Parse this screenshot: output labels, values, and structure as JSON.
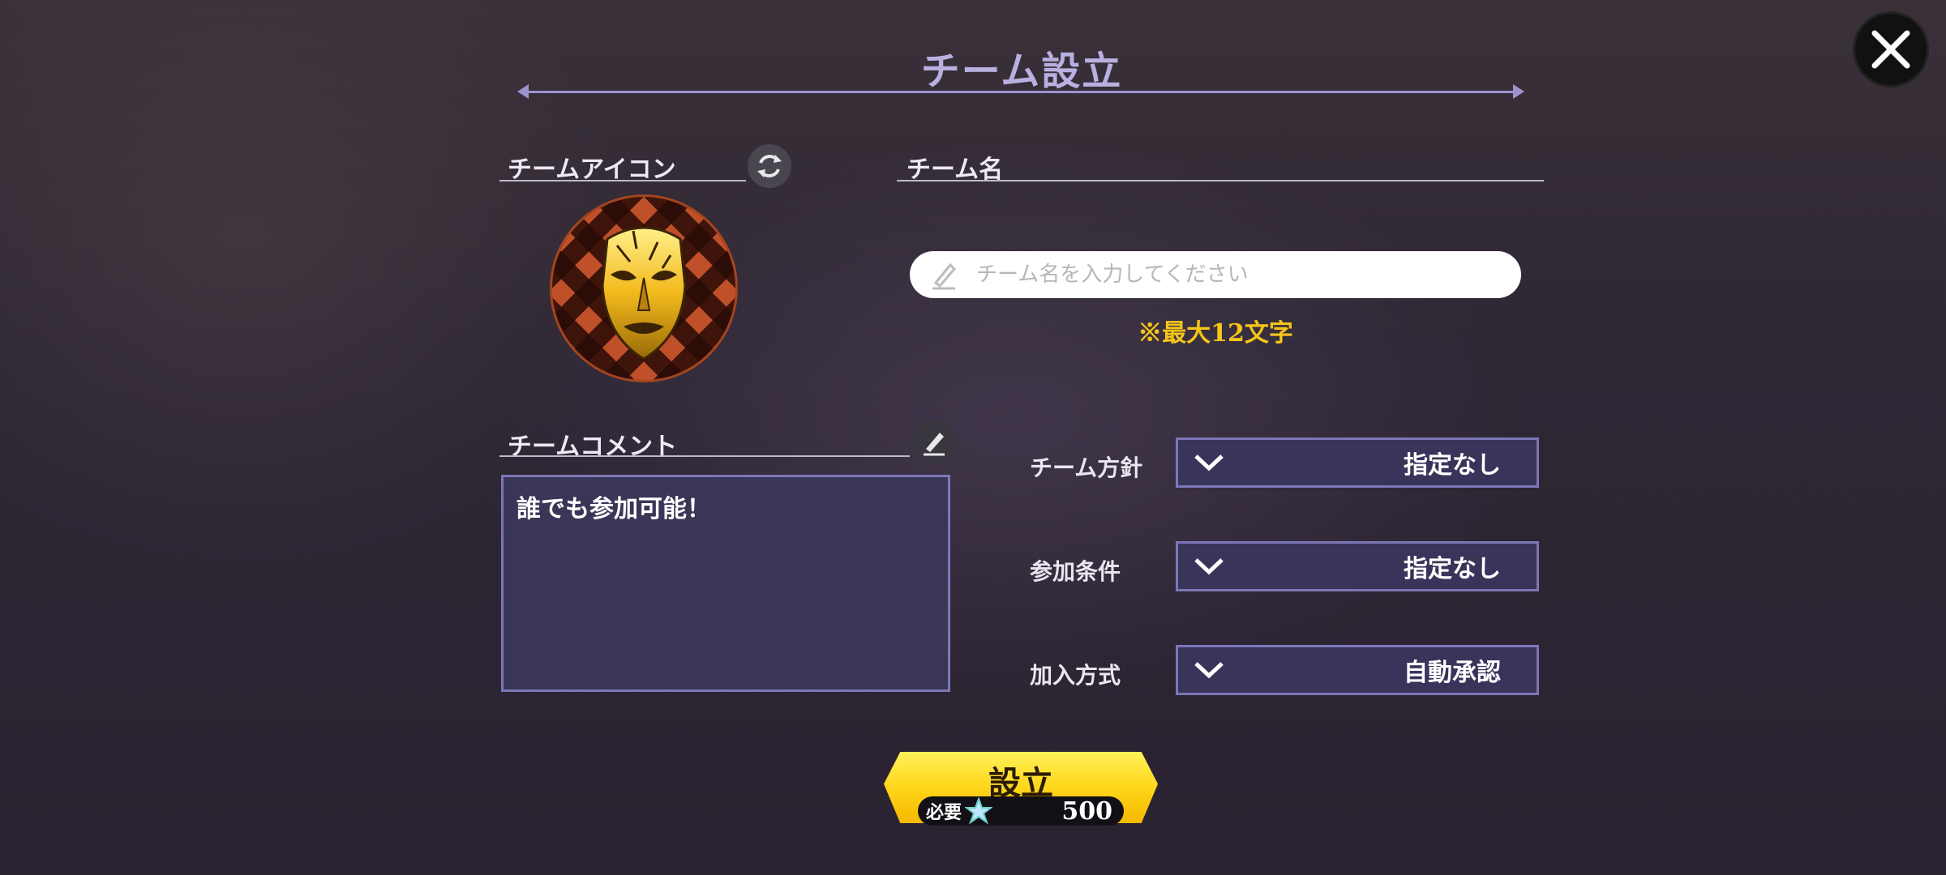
{
  "header": {
    "title": "チーム設立"
  },
  "icon_section": {
    "label": "チームアイコン"
  },
  "name_section": {
    "label": "チーム名",
    "input_value": "",
    "placeholder": "チーム名を入力してください",
    "note": "※最大12文字"
  },
  "comment_section": {
    "label": "チームコメント",
    "text": "誰でも参加可能！"
  },
  "settings": [
    {
      "label": "チーム方針",
      "value": "指定なし"
    },
    {
      "label": "参加条件",
      "value": "指定なし"
    },
    {
      "label": "加入方式",
      "value": "自動承認"
    }
  ],
  "establish_button": {
    "label": "設立",
    "cost_label": "必要",
    "cost_value": "500"
  },
  "colors": {
    "title": "#b8b0e0",
    "note": "#f5c518",
    "box_border": "#7d77b8",
    "button": "#ffd61a"
  },
  "icons": [
    "close-icon",
    "refresh-icon",
    "pencil-icon",
    "chevron-down-icon",
    "star-icon",
    "stone-mask-emblem"
  ]
}
